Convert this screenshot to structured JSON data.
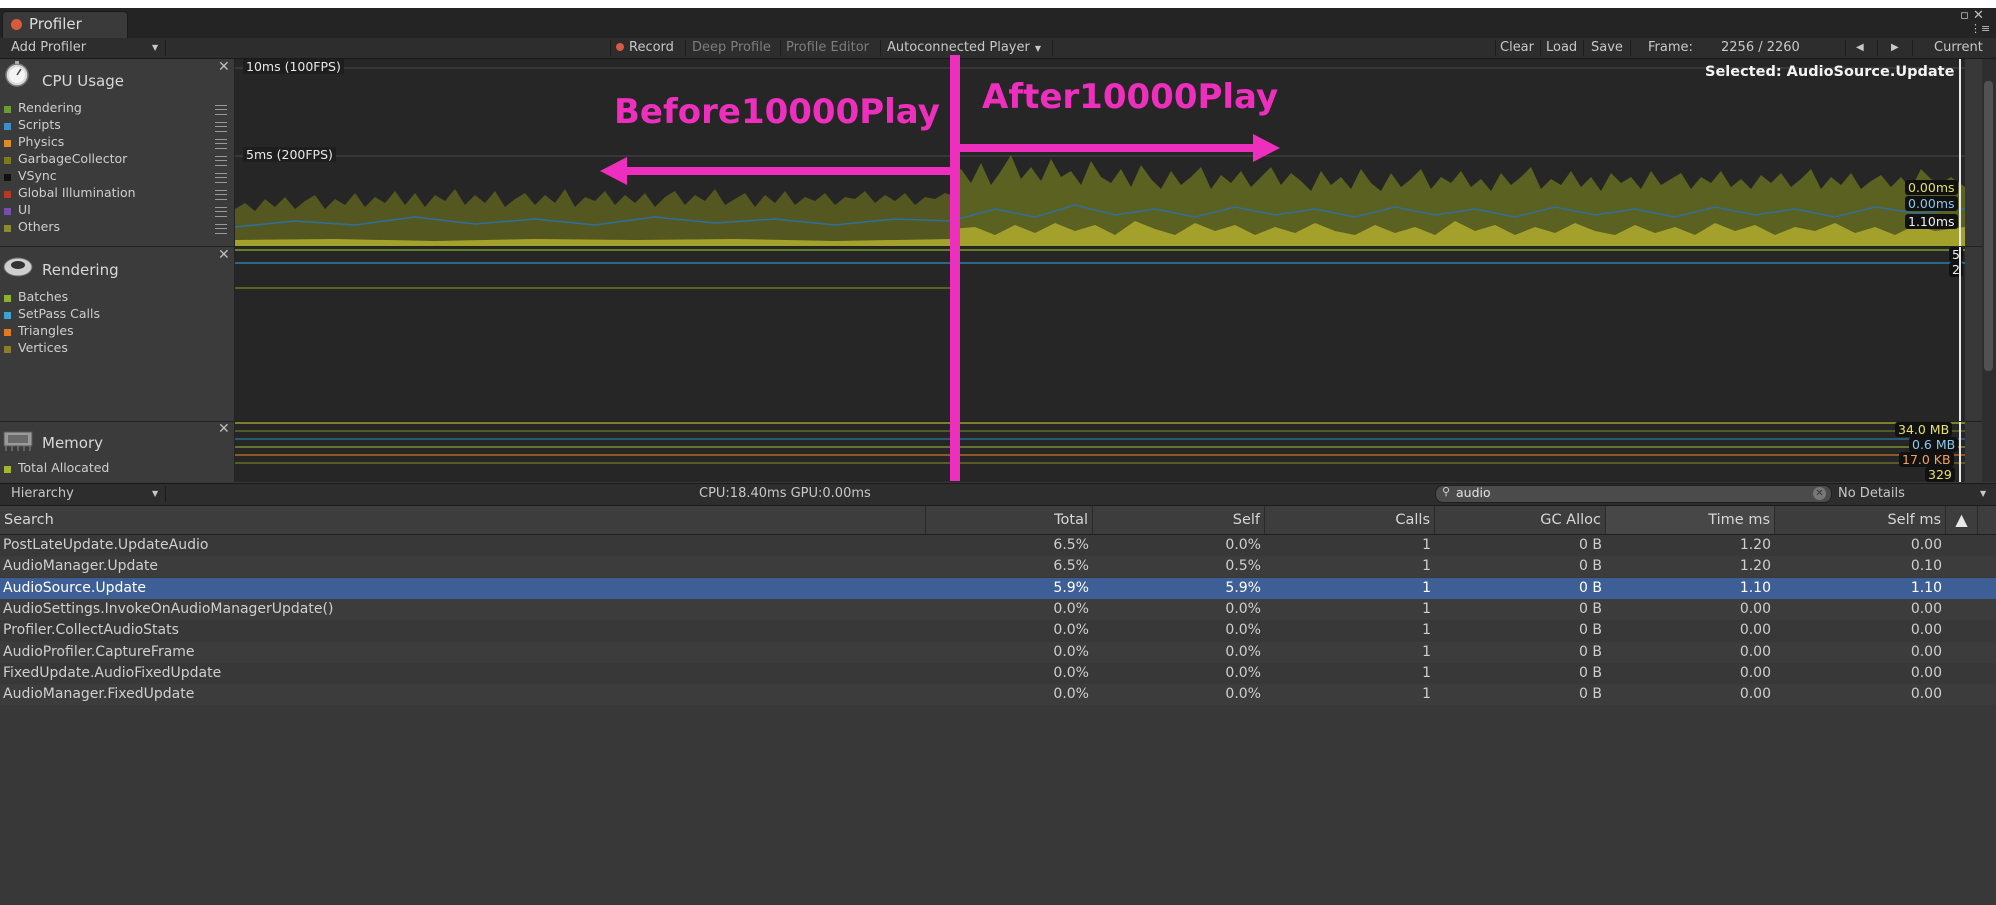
{
  "window": {
    "tab_title": "Profiler",
    "controls": [
      "▫ ✕",
      "⋮≡"
    ]
  },
  "toolbar": {
    "add_profiler": "Add Profiler",
    "record": "Record",
    "deep_profile": "Deep Profile",
    "profile_editor": "Profile Editor",
    "player": "Autoconnected Player",
    "clear": "Clear",
    "load": "Load",
    "save": "Save",
    "frame_label": "Frame:",
    "frame_value": "2256 / 2260",
    "current": "Current"
  },
  "cpu_usage": {
    "title": "CPU Usage",
    "legend": [
      {
        "label": "Rendering",
        "color": "#6b9b32"
      },
      {
        "label": "Scripts",
        "color": "#3b8fc4"
      },
      {
        "label": "Physics",
        "color": "#e08a25"
      },
      {
        "label": "GarbageCollector",
        "color": "#7a7a22"
      },
      {
        "label": "VSync",
        "color": "#111111"
      },
      {
        "label": "Global Illumination",
        "color": "#b53a24"
      },
      {
        "label": "UI",
        "color": "#7b4cb0"
      },
      {
        "label": "Others",
        "color": "#8a8a30"
      }
    ],
    "y_label_top": "10ms (100FPS)",
    "y_label_mid": "5ms (200FPS)",
    "selected": "Selected: AudioSource.Update",
    "values": [
      "0.00ms",
      "0.00ms",
      "1.10ms"
    ]
  },
  "rendering": {
    "title": "Rendering",
    "legend": [
      {
        "label": "Batches",
        "color": "#8fb02e"
      },
      {
        "label": "SetPass Calls",
        "color": "#3aa3d6"
      },
      {
        "label": "Triangles",
        "color": "#e07a20"
      },
      {
        "label": "Vertices",
        "color": "#8a7e2a"
      }
    ],
    "values": [
      "5",
      "2"
    ]
  },
  "memory": {
    "title": "Memory",
    "legend": [
      {
        "label": "Total Allocated",
        "color": "#a6b42e"
      }
    ],
    "values": [
      "34.0 MB",
      "0.6 MB",
      "17.0 KB",
      "329"
    ]
  },
  "annotations": {
    "before": "Before10000Play",
    "after": "After10000Play",
    "color": "#ee2fbd"
  },
  "hierarchy": {
    "view": "Hierarchy",
    "cpu_gpu": "CPU:18.40ms   GPU:0.00ms",
    "search_value": "audio",
    "details": "No Details"
  },
  "table": {
    "columns": [
      "Search",
      "Total",
      "Self",
      "Calls",
      "GC Alloc",
      "Time ms",
      "Self ms"
    ],
    "sort_glyph": "▲",
    "rows": [
      [
        "PostLateUpdate.UpdateAudio",
        "6.5%",
        "0.0%",
        "1",
        "0 B",
        "1.20",
        "0.00"
      ],
      [
        "AudioManager.Update",
        "6.5%",
        "0.5%",
        "1",
        "0 B",
        "1.20",
        "0.10"
      ],
      [
        "AudioSource.Update",
        "5.9%",
        "5.9%",
        "1",
        "0 B",
        "1.10",
        "1.10"
      ],
      [
        "AudioSettings.InvokeOnAudioManagerUpdate()",
        "0.0%",
        "0.0%",
        "1",
        "0 B",
        "0.00",
        "0.00"
      ],
      [
        "Profiler.CollectAudioStats",
        "0.0%",
        "0.0%",
        "1",
        "0 B",
        "0.00",
        "0.00"
      ],
      [
        "AudioProfiler.CaptureFrame",
        "0.0%",
        "0.0%",
        "1",
        "0 B",
        "0.00",
        "0.00"
      ],
      [
        "FixedUpdate.AudioFixedUpdate",
        "0.0%",
        "0.0%",
        "1",
        "0 B",
        "0.00",
        "0.00"
      ],
      [
        "AudioManager.FixedUpdate",
        "0.0%",
        "0.0%",
        "1",
        "0 B",
        "0.00",
        "0.00"
      ]
    ],
    "selected_row": 2
  }
}
